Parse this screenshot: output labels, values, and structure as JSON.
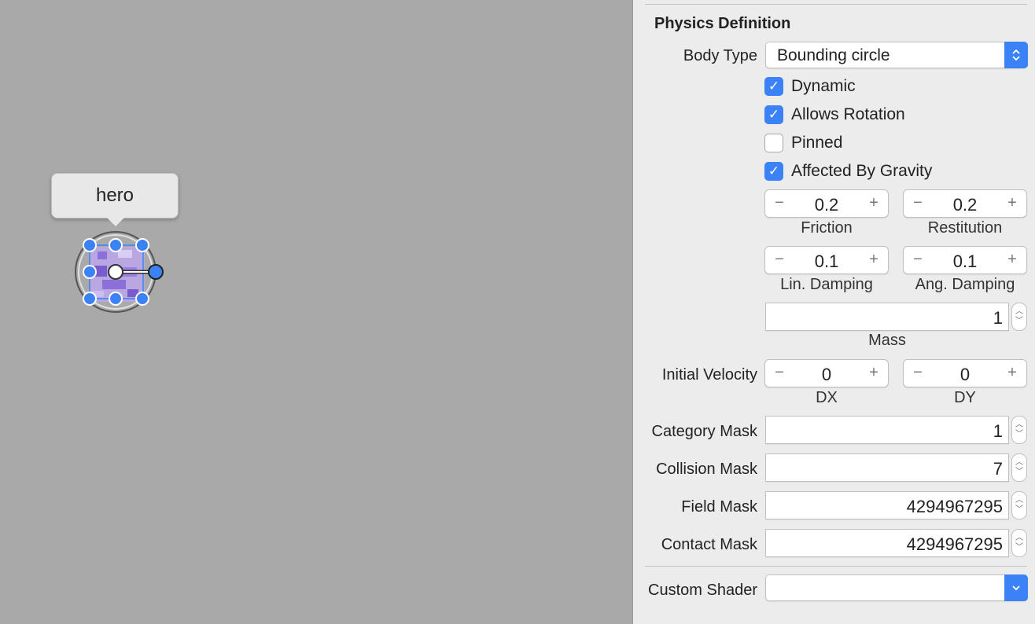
{
  "canvas": {
    "background": "#a9a9a9",
    "node_name": "hero",
    "selection_color": "#3b82f6"
  },
  "inspector": {
    "section_title": "Physics Definition",
    "body_type": {
      "label": "Body Type",
      "value": "Bounding circle"
    },
    "checks": [
      {
        "label": "Dynamic",
        "checked": true
      },
      {
        "label": "Allows Rotation",
        "checked": true
      },
      {
        "label": "Pinned",
        "checked": false
      },
      {
        "label": "Affected By Gravity",
        "checked": true
      }
    ],
    "friction": {
      "label": "Friction",
      "value": "0.2"
    },
    "restitution": {
      "label": "Restitution",
      "value": "0.2"
    },
    "lin_damping": {
      "label": "Lin. Damping",
      "value": "0.1"
    },
    "ang_damping": {
      "label": "Ang. Damping",
      "value": "0.1"
    },
    "mass": {
      "label": "Mass",
      "value": "1"
    },
    "initial_velocity": {
      "label": "Initial Velocity",
      "dx": {
        "label": "DX",
        "value": "0"
      },
      "dy": {
        "label": "DY",
        "value": "0"
      }
    },
    "category_mask": {
      "label": "Category Mask",
      "value": "1"
    },
    "collision_mask": {
      "label": "Collision Mask",
      "value": "7"
    },
    "field_mask": {
      "label": "Field Mask",
      "value": "4294967295"
    },
    "contact_mask": {
      "label": "Contact Mask",
      "value": "4294967295"
    },
    "custom_shader": {
      "label": "Custom Shader",
      "value": ""
    },
    "stepper_minus": "−",
    "stepper_plus": "+",
    "check_glyph": "✓",
    "accent": "#3b82f6"
  }
}
